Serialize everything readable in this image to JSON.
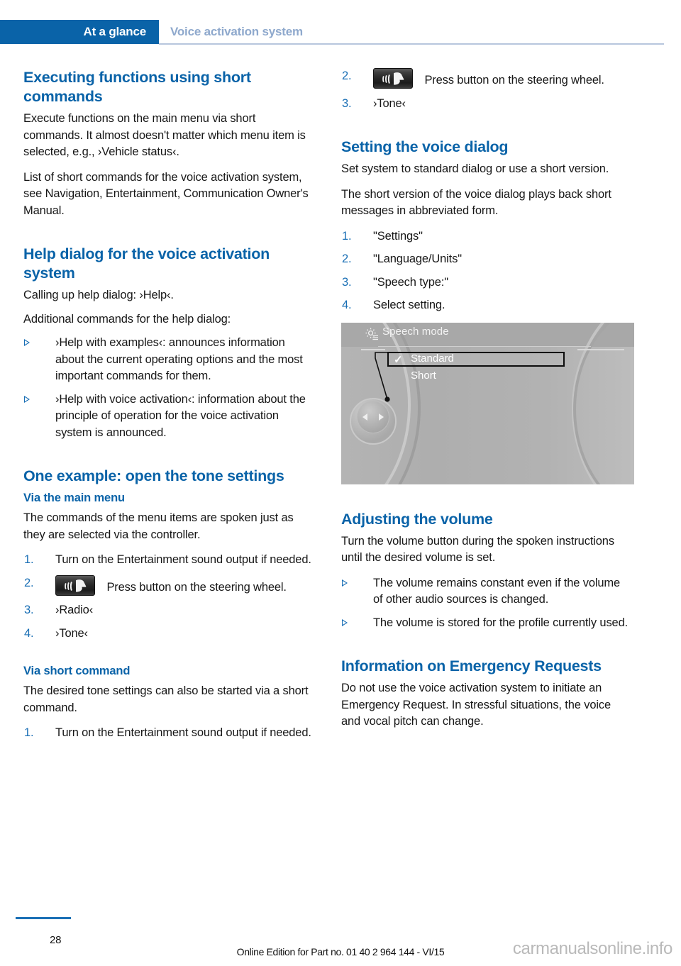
{
  "header": {
    "chapter_tab": "At a glance",
    "section": "Voice activation system",
    "accent_color": "#0a63a8"
  },
  "left_column": {
    "s1_heading": "Executing functions using short commands",
    "s1_p1": "Execute functions on the main menu via short commands. It almost doesn't matter which menu item is selected, e.g., ›Vehicle status‹.",
    "s1_p2": "List of short commands for the voice activation system, see Navigation, Entertainment, Communication Owner's Manual.",
    "s2_heading": "Help dialog for the voice activation system",
    "s2_p1": "Calling up help dialog: ›Help‹.",
    "s2_p2": "Additional commands for the help dialog:",
    "s2_bullets": [
      "›Help with examples‹: announces information about the current operating options and the most important commands for them.",
      "›Help with voice activation‹: information about the principle of operation for the voice activation system is announced."
    ],
    "s3_heading": "One example: open the tone settings",
    "s3_sub1": "Via the main menu",
    "s3_p1": "The commands of the menu items are spoken just as they are selected via the controller.",
    "s3_steps": [
      {
        "num": "1.",
        "text": "Turn on the Entertainment sound output if needed.",
        "icon": null
      },
      {
        "num": "2.",
        "text": "Press button on the steering wheel.",
        "icon": "voice-button-icon"
      },
      {
        "num": "3.",
        "text": "›Radio‹",
        "icon": null
      },
      {
        "num": "4.",
        "text": "›Tone‹",
        "icon": null
      }
    ],
    "s3_sub2": "Via short command",
    "s3_p2": "The desired tone settings can also be started via a short command.",
    "s3_steps2": [
      {
        "num": "1.",
        "text": "Turn on the Entertainment sound output if needed.",
        "icon": null
      }
    ]
  },
  "right_column": {
    "cont_steps": [
      {
        "num": "2.",
        "text": "Press button on the steering wheel.",
        "icon": "voice-button-icon"
      },
      {
        "num": "3.",
        "text": "›Tone‹",
        "icon": null
      }
    ],
    "s4_heading": "Setting the voice dialog",
    "s4_p1": "Set system to standard dialog or use a short version.",
    "s4_p2": "The short version of the voice dialog plays back short messages in abbreviated form.",
    "s4_steps": [
      {
        "num": "1.",
        "text": "\"Settings\""
      },
      {
        "num": "2.",
        "text": "\"Language/Units\""
      },
      {
        "num": "3.",
        "text": "\"Speech type:\""
      },
      {
        "num": "4.",
        "text": "Select setting."
      }
    ],
    "idrive": {
      "title": "Speech mode",
      "gear_icon": "settings-gear-icon",
      "options": [
        {
          "label": "Standard",
          "checked": true,
          "selected": true
        },
        {
          "label": "Short",
          "checked": false,
          "selected": false
        }
      ],
      "check_glyph": "✓"
    },
    "s5_heading": "Adjusting the volume",
    "s5_p1": "Turn the volume button during the spoken instructions until the desired volume is set.",
    "s5_bullets": [
      "The volume remains constant even if the volume of other audio sources is changed.",
      "The volume is stored for the profile currently used."
    ],
    "s6_heading": "Information on Emergency Requests",
    "s6_p1": "Do not use the voice activation system to initiate an Emergency Request. In stressful situations, the voice and vocal pitch can change."
  },
  "footer": {
    "page_number": "28",
    "edition_text": "Online Edition for Part no. 01 40 2 964 144 - VI/15",
    "watermark": "carmanualsonline.info"
  }
}
